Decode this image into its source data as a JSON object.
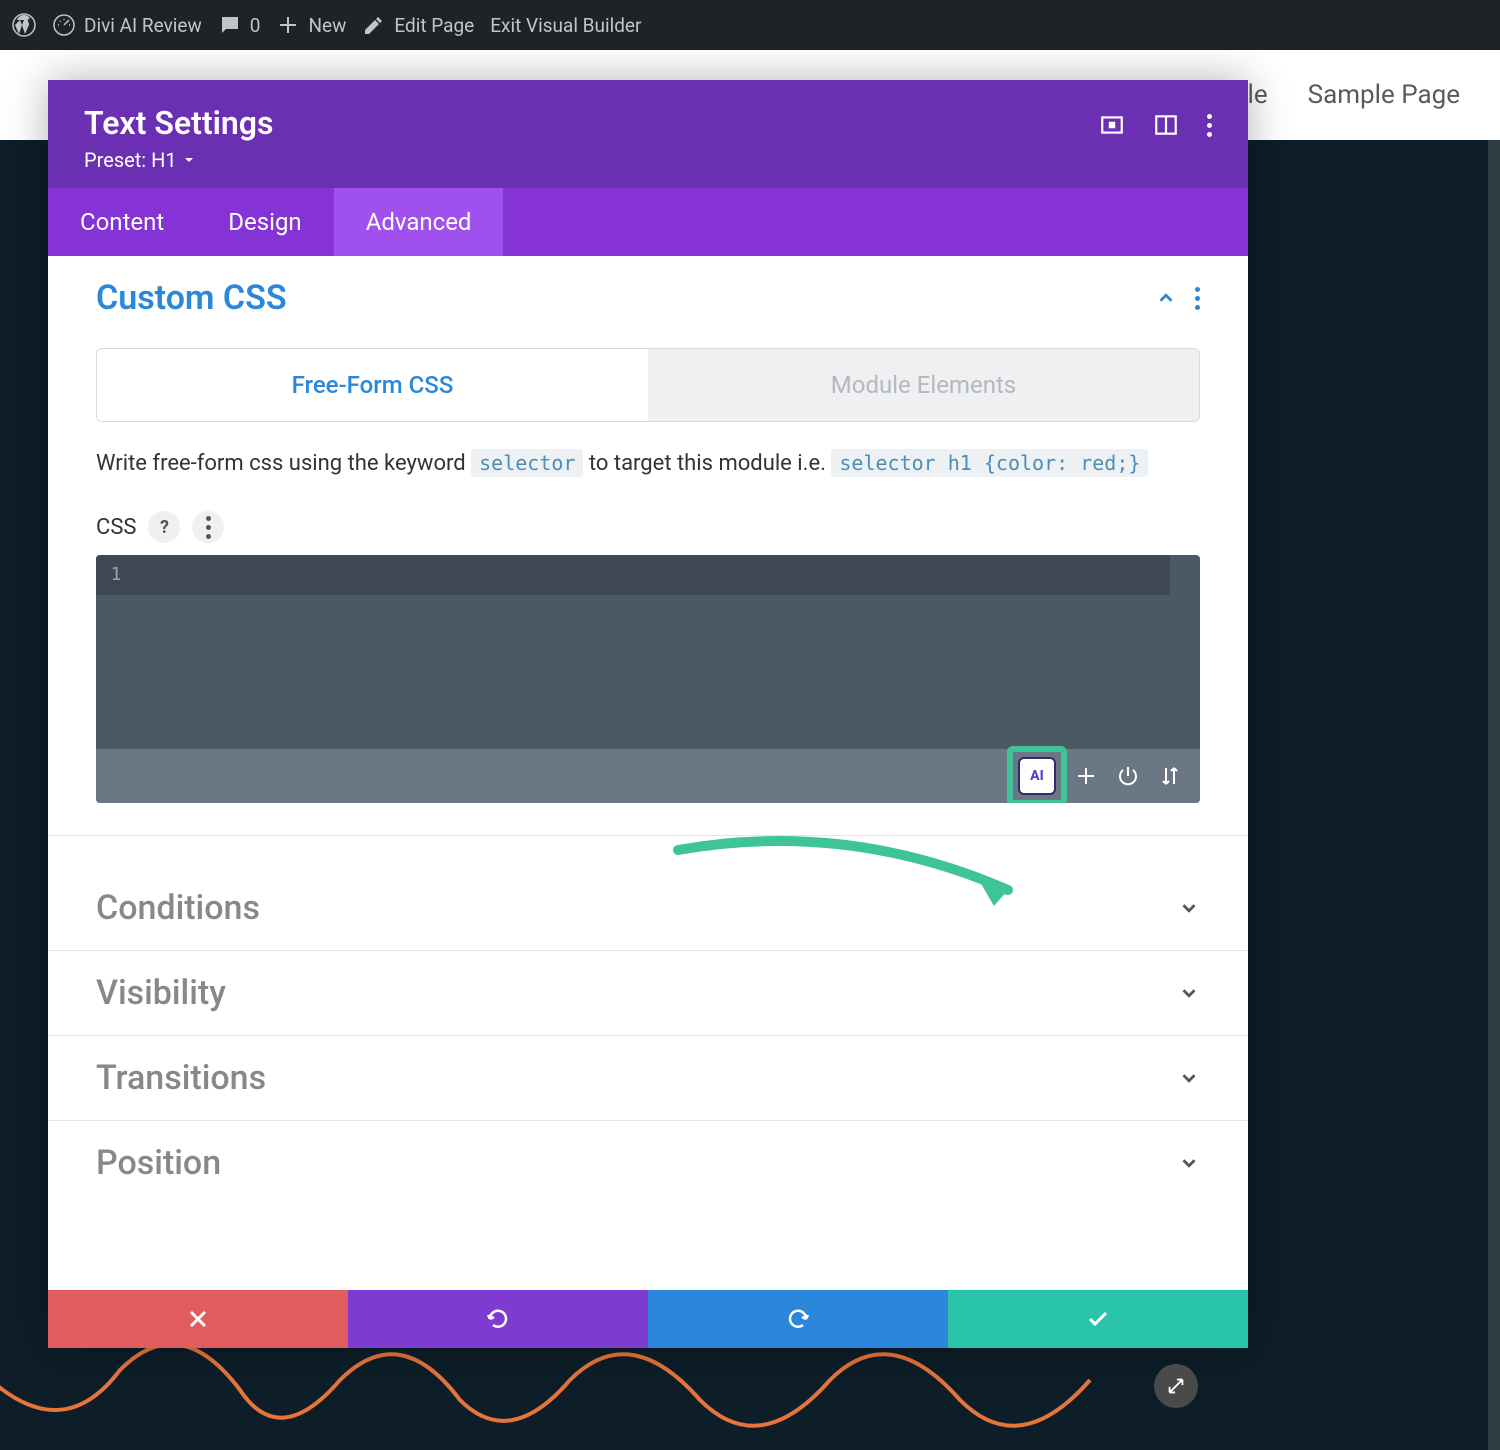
{
  "adminbar": {
    "site_title": "Divi AI Review",
    "comments_count": "0",
    "new_label": "New",
    "edit_page_label": "Edit Page",
    "exit_vb_label": "Exit Visual Builder"
  },
  "page_nav": {
    "item_partial": "ple",
    "sample_page": "Sample Page"
  },
  "modal": {
    "title": "Text Settings",
    "preset_label": "Preset: H1",
    "tabs": {
      "content": "Content",
      "design": "Design",
      "advanced": "Advanced"
    },
    "custom_css": {
      "title": "Custom CSS",
      "subtabs": {
        "freeform": "Free-Form CSS",
        "module_elements": "Module Elements"
      },
      "description_pre": "Write free-form css using the keyword ",
      "description_code1": "selector",
      "description_mid": " to target this module i.e. ",
      "description_code2": "selector h1 {color: red;}",
      "css_label": "CSS",
      "help_symbol": "?",
      "line_number": "1",
      "ai_label": "AI"
    },
    "sections": {
      "conditions": "Conditions",
      "visibility": "Visibility",
      "transitions": "Transitions",
      "position": "Position"
    }
  }
}
